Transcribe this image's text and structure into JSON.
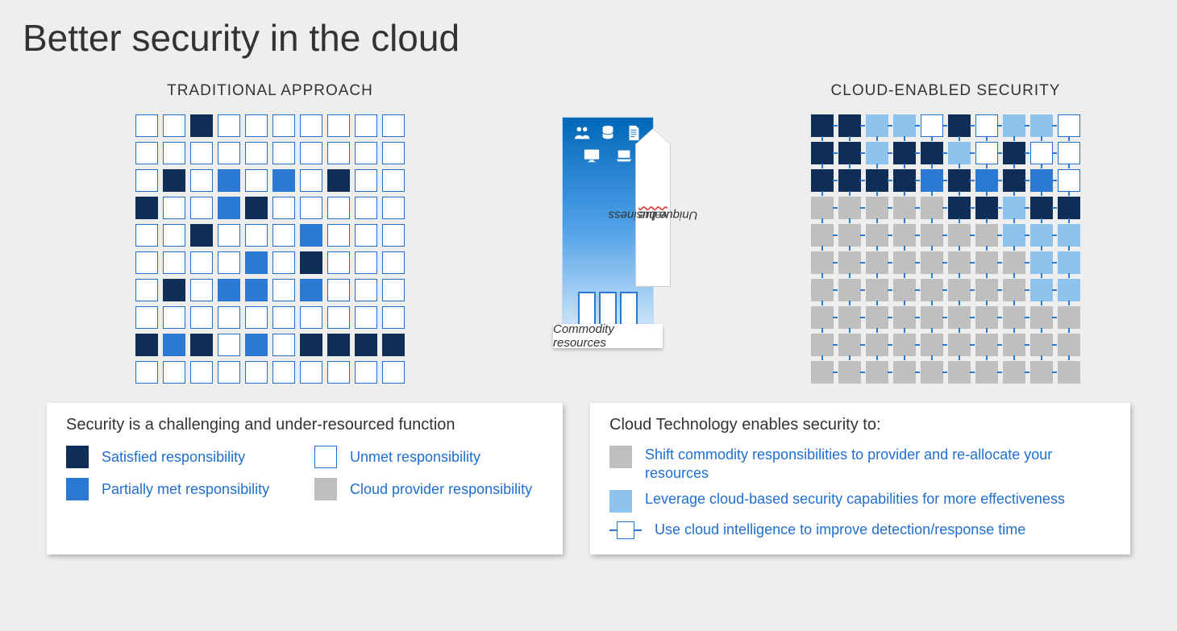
{
  "title": "Better security in the cloud",
  "columns": {
    "left_heading": "TRADITIONAL APPROACH",
    "right_heading": "CLOUD-ENABLED SECURITY"
  },
  "pillar": {
    "pointer_label_prefix": "Unique business ",
    "pointer_label_squiggle": "value",
    "commodity_label": "Commodity resources"
  },
  "left_card": {
    "heading": "Security is a challenging and under-resourced function",
    "legend": [
      {
        "cls": "navy",
        "label": "Satisfied responsibility"
      },
      {
        "cls": "",
        "label": "Unmet responsibility"
      },
      {
        "cls": "blue",
        "label": "Partially met responsibility"
      },
      {
        "cls": "gray",
        "label": "Cloud provider responsibility"
      }
    ]
  },
  "right_card": {
    "heading": "Cloud Technology enables security to:",
    "bullets": [
      {
        "icon": "gray",
        "label": "Shift commodity responsibilities to provider and re-allocate your resources"
      },
      {
        "icon": "sky",
        "label": "Leverage cloud-based security capabilities for more effectiveness"
      },
      {
        "icon": "node",
        "label": "Use cloud intelligence to improve detection/response time"
      }
    ]
  },
  "grids": {
    "traditional": [
      [
        "",
        "",
        "navy",
        "",
        "",
        "",
        "",
        "",
        "",
        ""
      ],
      [
        "",
        "",
        "",
        "",
        "",
        "",
        "",
        "",
        "",
        ""
      ],
      [
        "",
        "navy",
        "",
        "blue",
        "",
        "blue",
        "",
        "navy",
        "",
        ""
      ],
      [
        "navy",
        "",
        "",
        "blue",
        "navy",
        "",
        "",
        "",
        "",
        ""
      ],
      [
        "",
        "",
        "navy",
        "",
        "",
        "",
        "blue",
        "",
        "",
        ""
      ],
      [
        "",
        "",
        "",
        "",
        "blue",
        "",
        "navy",
        "",
        "",
        ""
      ],
      [
        "",
        "navy",
        "",
        "blue",
        "blue",
        "",
        "blue",
        "",
        "",
        ""
      ],
      [
        "",
        "",
        "",
        "",
        "",
        "",
        "",
        "",
        "",
        ""
      ],
      [
        "navy",
        "blue",
        "navy",
        "",
        "blue",
        "",
        "navy",
        "navy",
        "navy",
        "navy"
      ],
      [
        "",
        "",
        "",
        "",
        "",
        "",
        "",
        "",
        "",
        ""
      ]
    ],
    "cloud": [
      [
        "navy",
        "navy",
        "sky",
        "sky",
        "",
        "navy",
        "",
        "sky",
        "sky",
        ""
      ],
      [
        "navy",
        "navy",
        "sky",
        "navy",
        "navy",
        "sky",
        "",
        "navy",
        "",
        ""
      ],
      [
        "navy",
        "navy",
        "navy",
        "navy",
        "blue",
        "navy",
        "blue",
        "navy",
        "blue",
        ""
      ],
      [
        "gray",
        "gray",
        "gray",
        "gray",
        "gray",
        "navy",
        "navy",
        "sky",
        "navy",
        "navy"
      ],
      [
        "gray",
        "gray",
        "gray",
        "gray",
        "gray",
        "gray",
        "gray",
        "sky",
        "sky",
        "sky"
      ],
      [
        "gray",
        "gray",
        "gray",
        "gray",
        "gray",
        "gray",
        "gray",
        "gray",
        "sky",
        "sky"
      ],
      [
        "gray",
        "gray",
        "gray",
        "gray",
        "gray",
        "gray",
        "gray",
        "gray",
        "sky",
        "sky"
      ],
      [
        "gray",
        "gray",
        "gray",
        "gray",
        "gray",
        "gray",
        "gray",
        "gray",
        "gray",
        "gray"
      ],
      [
        "gray",
        "gray",
        "gray",
        "gray",
        "gray",
        "gray",
        "gray",
        "gray",
        "gray",
        "gray"
      ],
      [
        "gray",
        "gray",
        "gray",
        "gray",
        "gray",
        "gray",
        "gray",
        "gray",
        "gray",
        "gray"
      ]
    ]
  }
}
